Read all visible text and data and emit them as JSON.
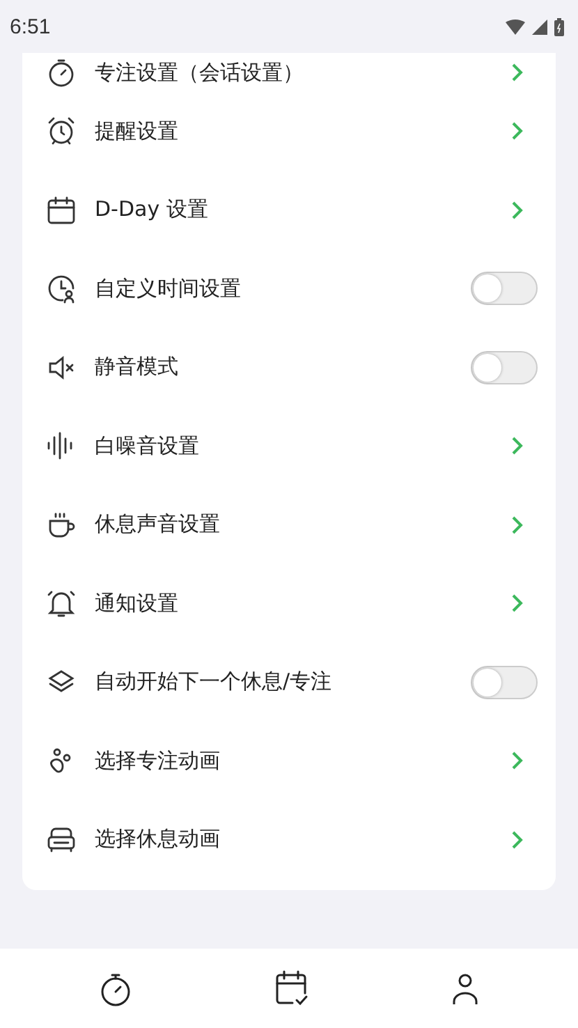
{
  "status_bar": {
    "time": "6:51"
  },
  "settings": [
    {
      "label": "专注设置（会话设置）",
      "kind": "link"
    },
    {
      "label": "提醒设置",
      "kind": "link"
    },
    {
      "label": "D-Day 设置",
      "kind": "link"
    },
    {
      "label": "自定义时间设置",
      "kind": "toggle",
      "on": false
    },
    {
      "label": "静音模式",
      "kind": "toggle",
      "on": false
    },
    {
      "label": "白噪音设置",
      "kind": "link"
    },
    {
      "label": "休息声音设置",
      "kind": "link"
    },
    {
      "label": "通知设置",
      "kind": "link"
    },
    {
      "label": "自动开始下一个休息/专注",
      "kind": "toggle",
      "on": false
    },
    {
      "label": "选择专注动画",
      "kind": "link"
    },
    {
      "label": "选择休息动画",
      "kind": "link"
    }
  ]
}
